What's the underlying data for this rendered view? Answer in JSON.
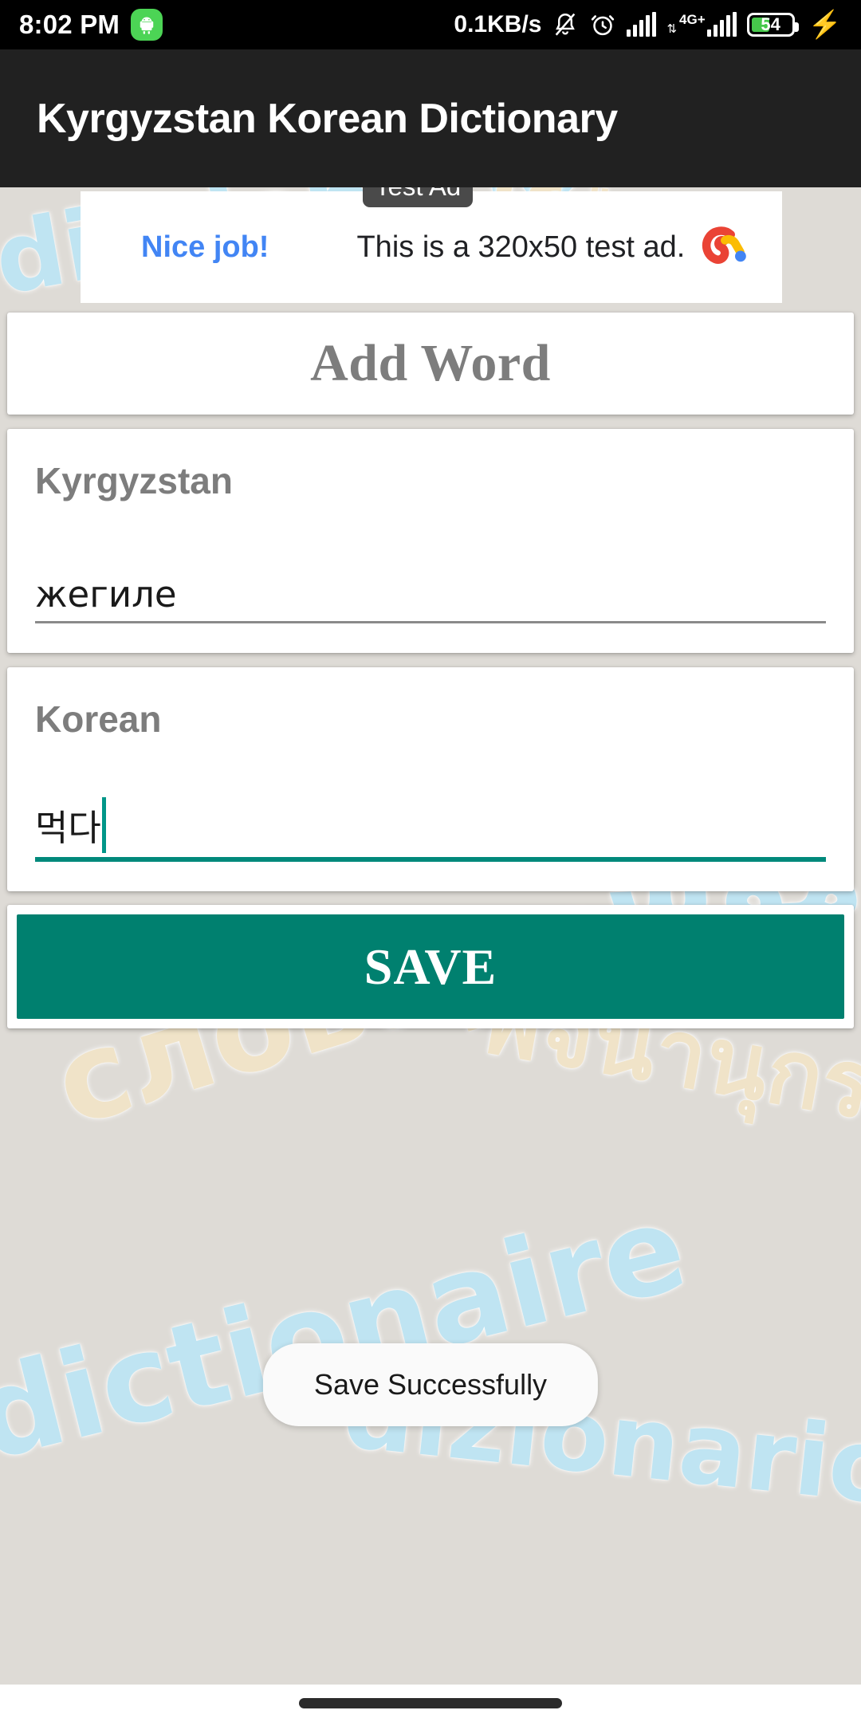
{
  "status_bar": {
    "time": "8:02 PM",
    "android_icon": "android-robot-icon",
    "network_speed": "0.1KB/s",
    "silent_icon": "bell-muted-icon",
    "alarm_icon": "alarm-clock-icon",
    "signal1_icon": "signal-bars-icon",
    "network_type": "4G+",
    "data_transfer_icon": "data-updown-icon",
    "signal2_icon": "signal-bars-icon",
    "battery_level": "54",
    "charging_icon": "charging-bolt-icon",
    "battery_color": "#46C84B"
  },
  "app_bar": {
    "title": "Kyrgyzstan Korean Dictionary",
    "background_color": "#212121"
  },
  "ad": {
    "badge": "Test Ad",
    "headline": "Nice job!",
    "body": "This is a 320x50 test ad.",
    "logo_icon": "admob-logo-icon",
    "headline_color": "#4285F4"
  },
  "form": {
    "heading": "Add Word",
    "fields": [
      {
        "label": "Kyrgyzstan",
        "value": "жегиле",
        "placeholder": "",
        "focused": false,
        "underline_color": "#8A8A8A"
      },
      {
        "label": "Korean",
        "value": "먹다",
        "placeholder": "",
        "focused": true,
        "underline_color": "#00897B"
      }
    ],
    "save_label": "SAVE",
    "save_color": "#00806F"
  },
  "toast": {
    "message": "Save Successfully"
  },
  "background_watermarks": [
    {
      "text": "diccionario",
      "color": "#BFE4F2"
    },
    {
      "text": "ةغل",
      "color": "#F0E3C8"
    },
    {
      "text": "dicionário",
      "color": "#BFE4F2"
    },
    {
      "text": "словарь",
      "color": "#F0E3C8"
    },
    {
      "text": "قاموس",
      "color": "#BFE4F2"
    },
    {
      "text": "พจนานุกรม",
      "color": "#F0E3C8"
    },
    {
      "text": "dictionaire",
      "color": "#BFE4F2"
    },
    {
      "text": "dizionario",
      "color": "#BFE4F2"
    }
  ],
  "nav_bar": {
    "home_indicator": "home-indicator-pill"
  }
}
